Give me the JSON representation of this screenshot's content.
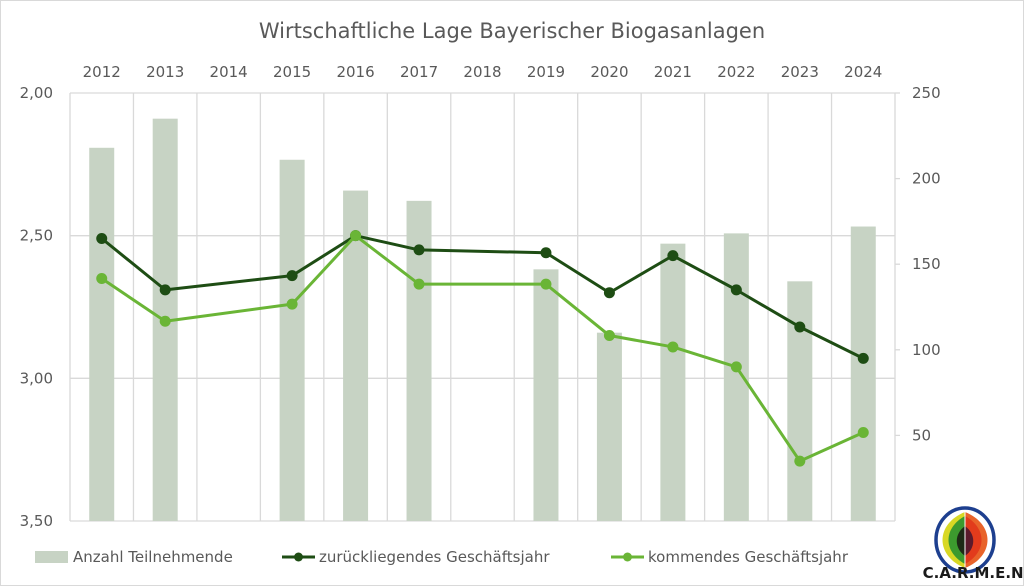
{
  "chart_data": {
    "type": "bar",
    "title": "Wirtschaftliche Lage Bayerischer Biogasanlagen",
    "categories": [
      "2012",
      "2013",
      "2014",
      "2015",
      "2016",
      "2017",
      "2018",
      "2019",
      "2020",
      "2021",
      "2022",
      "2023",
      "2024"
    ],
    "xlabel": "",
    "x_axis_position": "top",
    "ylabel_left": "",
    "ylabel_right": "",
    "left_axis": {
      "range": [
        2.0,
        3.5
      ],
      "inverted": true,
      "ticks": [
        "2,00",
        "2,50",
        "3,00",
        "3,50"
      ],
      "tick_values": [
        2.0,
        2.5,
        3.0,
        3.5
      ]
    },
    "right_axis": {
      "range": [
        0,
        250
      ],
      "ticks": [
        "250",
        "200",
        "150",
        "100",
        "50"
      ],
      "tick_values": [
        250,
        200,
        150,
        100,
        50
      ]
    },
    "grid": true,
    "legend_position": "bottom",
    "series": [
      {
        "name": "Anzahl Teilnehmende",
        "type": "bar",
        "axis": "right",
        "color": "#c7d3c4",
        "values": [
          218,
          235,
          null,
          211,
          193,
          187,
          null,
          147,
          110,
          162,
          168,
          140,
          172
        ]
      },
      {
        "name": "zurückliegendes Geschäftsjahr",
        "type": "line",
        "axis": "left",
        "color": "#1e4d14",
        "values": [
          2.51,
          2.69,
          null,
          2.64,
          2.5,
          2.55,
          null,
          2.56,
          2.7,
          2.57,
          2.69,
          2.82,
          2.93
        ]
      },
      {
        "name": "kommendes Geschäftsjahr",
        "type": "line",
        "axis": "left",
        "color": "#6ab536",
        "values": [
          2.65,
          2.8,
          null,
          2.74,
          2.5,
          2.67,
          null,
          2.67,
          2.85,
          2.89,
          2.96,
          3.29,
          3.19
        ]
      }
    ]
  },
  "logo": {
    "text": "C.A.R.M.E.N.",
    "colors": {
      "ring": "#1d3f8f",
      "yellow": "#d8d824",
      "green": "#3c9a2e",
      "red": "#e23b1c",
      "orange": "#e8632a",
      "dark_left": "#1d2a16",
      "dark_right": "#5a1a2c"
    }
  }
}
